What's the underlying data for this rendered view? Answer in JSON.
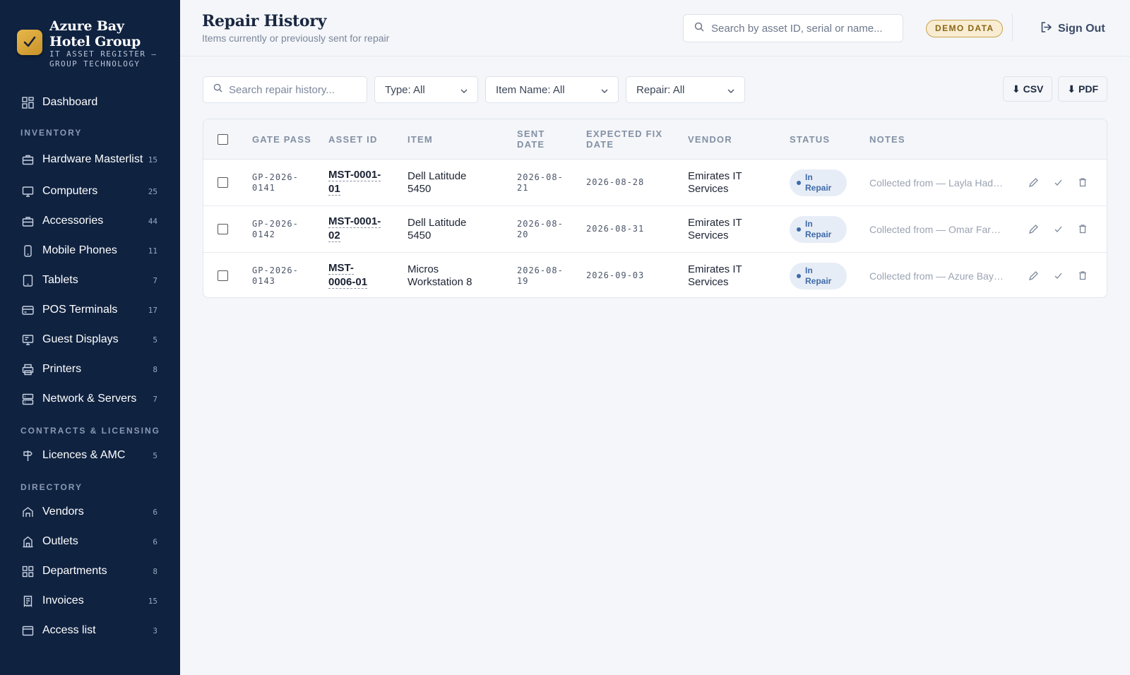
{
  "brand": {
    "name": "Azure Bay Hotel Group",
    "subtitle": "IT ASSET REGISTER — GROUP TECHNOLOGY"
  },
  "sidebar": {
    "dashboard": "Dashboard",
    "sections": {
      "inventory": "INVENTORY",
      "contracts": "CONTRACTS & LICENSING",
      "directory": "DIRECTORY"
    },
    "inventory": [
      {
        "label": "Hardware Masterlist",
        "count": "15",
        "icon": "hardware-icon"
      },
      {
        "label": "Computers",
        "count": "25",
        "icon": "monitor-icon"
      },
      {
        "label": "Accessories",
        "count": "44",
        "icon": "briefcase-icon"
      },
      {
        "label": "Mobile Phones",
        "count": "11",
        "icon": "phone-icon"
      },
      {
        "label": "Tablets",
        "count": "7",
        "icon": "tablet-icon"
      },
      {
        "label": "POS Terminals",
        "count": "17",
        "icon": "card-icon"
      },
      {
        "label": "Guest Displays",
        "count": "5",
        "icon": "display-icon"
      },
      {
        "label": "Printers",
        "count": "8",
        "icon": "printer-icon"
      },
      {
        "label": "Network & Servers",
        "count": "7",
        "icon": "server-icon"
      }
    ],
    "contracts": [
      {
        "label": "Licences & AMC",
        "count": "5",
        "icon": "signpost-icon"
      }
    ],
    "directory": [
      {
        "label": "Vendors",
        "count": "6",
        "icon": "store-icon"
      },
      {
        "label": "Outlets",
        "count": "6",
        "icon": "building-icon"
      },
      {
        "label": "Departments",
        "count": "8",
        "icon": "grid-icon"
      },
      {
        "label": "Invoices",
        "count": "15",
        "icon": "invoice-icon"
      },
      {
        "label": "Access list",
        "count": "3",
        "icon": "window-icon"
      }
    ]
  },
  "header": {
    "title": "Repair History",
    "subtitle": "Items currently or previously sent for repair",
    "search_placeholder": "Search by asset ID, serial or name...",
    "badge": "DEMO DATA",
    "signout": "Sign Out"
  },
  "filters": {
    "search_placeholder": "Search repair history...",
    "type": "Type: All",
    "item_name": "Item Name: All",
    "repair": "Repair: All",
    "csv": "⬇ CSV",
    "pdf": "⬇ PDF"
  },
  "table": {
    "columns": {
      "gate_pass": "GATE PASS",
      "asset_id": "ASSET ID",
      "item": "ITEM",
      "sent_date": "SENT DATE",
      "expected": "EXPECTED FIX DATE",
      "vendor": "VENDOR",
      "status": "STATUS",
      "notes": "NOTES"
    },
    "rows": [
      {
        "gate_pass": "GP-2026-0141",
        "asset_id": "MST-0001-01",
        "item": "Dell Latitude 5450",
        "sent": "2026-08-21",
        "expected": "2026-08-28",
        "vendor": "Emirates IT Services",
        "status": "In Repair",
        "notes": "Collected from — Layla Haddad"
      },
      {
        "gate_pass": "GP-2026-0142",
        "asset_id": "MST-0001-02",
        "item": "Dell Latitude 5450",
        "sent": "2026-08-20",
        "expected": "2026-08-31",
        "vendor": "Emirates IT Services",
        "status": "In Repair",
        "notes": "Collected from — Omar Farouk"
      },
      {
        "gate_pass": "GP-2026-0143",
        "asset_id": "MST-0006-01",
        "item": "Micros Workstation 8",
        "sent": "2026-08-19",
        "expected": "2026-09-03",
        "vendor": "Emirates IT Services",
        "status": "In Repair",
        "notes": "Collected from — Azure Bay Marina"
      }
    ]
  }
}
